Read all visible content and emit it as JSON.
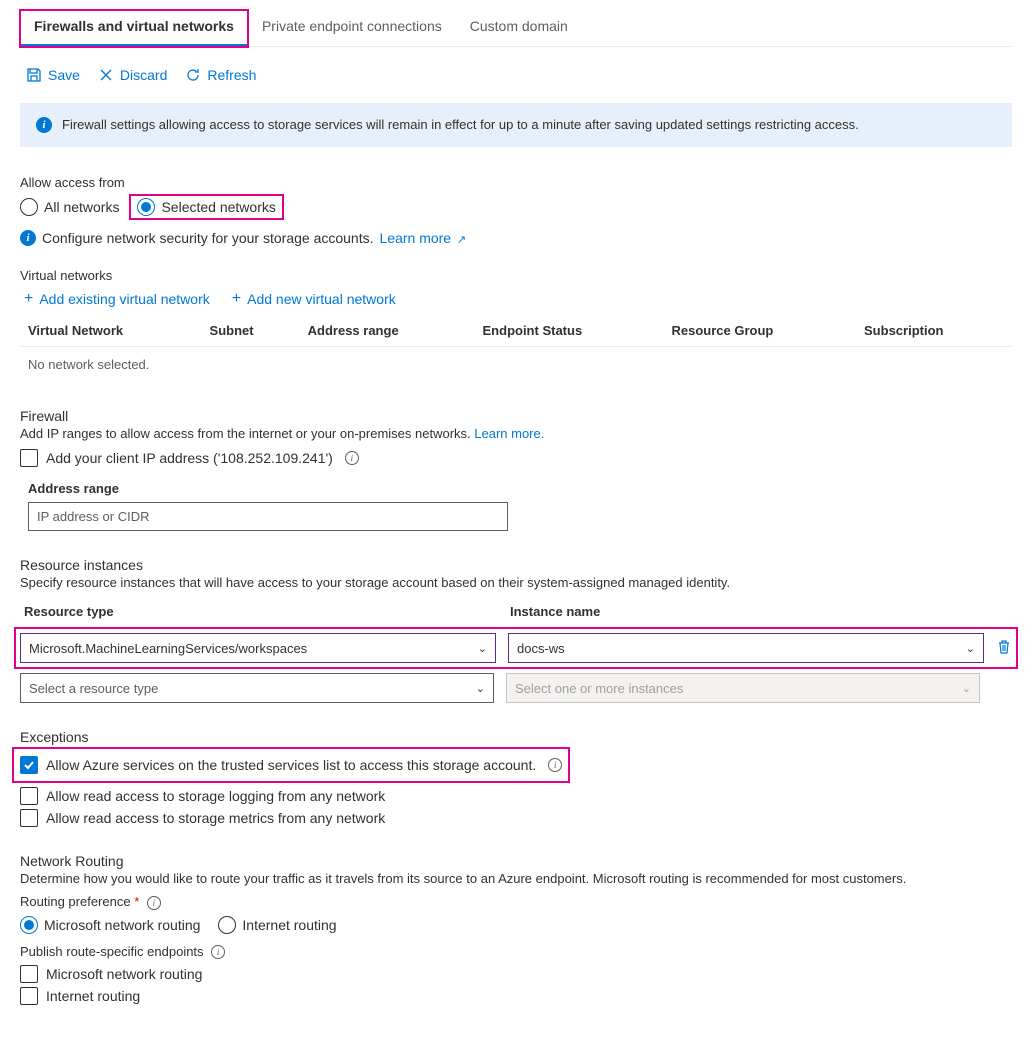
{
  "tabs": {
    "firewalls": "Firewalls and virtual networks",
    "pec": "Private endpoint connections",
    "custom_domain": "Custom domain"
  },
  "toolbar": {
    "save": "Save",
    "discard": "Discard",
    "refresh": "Refresh"
  },
  "banner": "Firewall settings allowing access to storage services will remain in effect for up to a minute after saving updated settings restricting access.",
  "access": {
    "label": "Allow access from",
    "all": "All networks",
    "selected": "Selected networks",
    "configure": "Configure network security for your storage accounts.",
    "learn_more": "Learn more"
  },
  "vnet": {
    "heading": "Virtual networks",
    "add_existing": "Add existing virtual network",
    "add_new": "Add new virtual network",
    "cols": {
      "c1": "Virtual Network",
      "c2": "Subnet",
      "c3": "Address range",
      "c4": "Endpoint Status",
      "c5": "Resource Group",
      "c6": "Subscription"
    },
    "empty": "No network selected."
  },
  "firewall": {
    "heading": "Firewall",
    "desc": "Add IP ranges to allow access from the internet or your on-premises networks.",
    "learn_more": "Learn more.",
    "add_client_ip": "Add your client IP address ('108.252.109.241')",
    "addr_label": "Address range",
    "addr_placeholder": "IP address or CIDR"
  },
  "ri": {
    "heading": "Resource instances",
    "desc": "Specify resource instances that will have access to your storage account based on their system-assigned managed identity.",
    "rtype_hdr": "Resource type",
    "iname_hdr": "Instance name",
    "row": {
      "rtype": "Microsoft.MachineLearningServices/workspaces",
      "iname": "docs-ws"
    },
    "rtype_placeholder": "Select a resource type",
    "iname_placeholder": "Select one or more instances"
  },
  "exceptions": {
    "heading": "Exceptions",
    "e1": "Allow Azure services on the trusted services list to access this storage account.",
    "e2": "Allow read access to storage logging from any network",
    "e3": "Allow read access to storage metrics from any network"
  },
  "routing": {
    "heading": "Network Routing",
    "desc": "Determine how you would like to route your traffic as it travels from its source to an Azure endpoint. Microsoft routing is recommended for most customers.",
    "pref_label": "Routing preference",
    "ms": "Microsoft network routing",
    "inet": "Internet routing",
    "pub_label": "Publish route-specific endpoints"
  }
}
